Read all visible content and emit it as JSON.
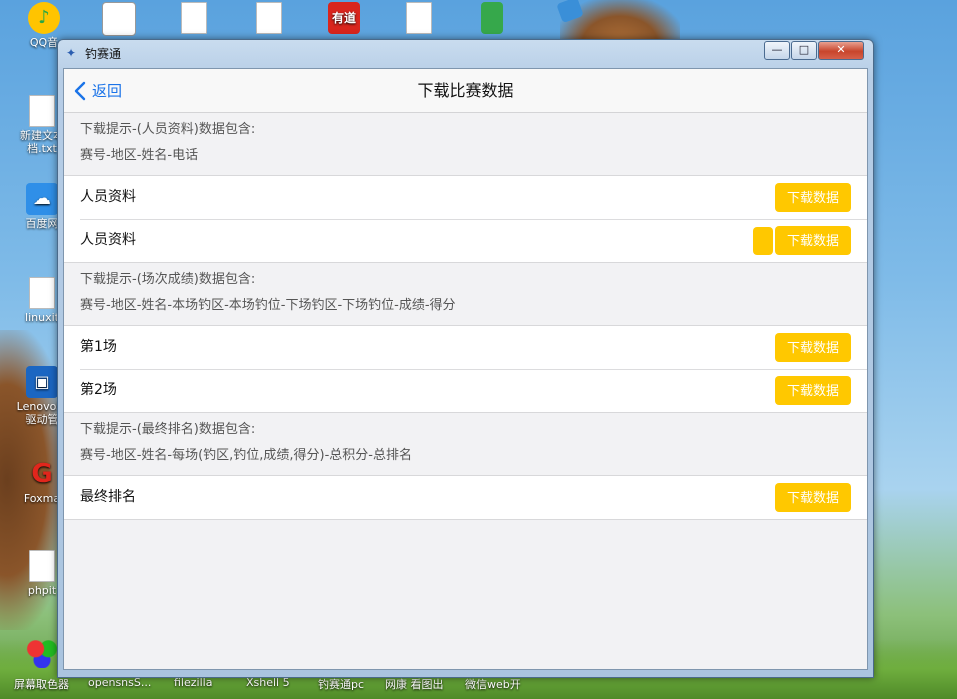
{
  "desktop": {
    "icons": [
      {
        "name": "qq-music",
        "label": "QQ音"
      },
      {
        "name": "new-text-doc",
        "label": "新建文本\n档.txt"
      },
      {
        "name": "baidu-netdisk",
        "label": "百度网"
      },
      {
        "name": "linux-txt",
        "label": "linuxit"
      },
      {
        "name": "lenovo-driver",
        "label": "Lenovo驱\n驱动管"
      },
      {
        "name": "foxmail",
        "label": "Foxma"
      },
      {
        "name": "php-txt",
        "label": "phpit"
      }
    ],
    "top_icons": [
      {
        "name": "youdao",
        "label": "有道"
      }
    ],
    "taskbar_labels": [
      "屏幕取色器",
      "opensnsS...",
      "filezilla",
      "Xshell 5",
      "钓赛通pc",
      "网康 看图出",
      "微信web开"
    ]
  },
  "window": {
    "title": "钓赛通",
    "min": "—",
    "max": "□",
    "close": "✕"
  },
  "navbar": {
    "back_label": "返回",
    "title": "下载比赛数据"
  },
  "sections": [
    {
      "hint_title": "下载提示-(人员资料)数据包含:",
      "hint_fields": "赛号-地区-姓名-电话",
      "rows": [
        {
          "label": "人员资料",
          "button": "下载数据"
        },
        {
          "label": "人员资料",
          "button": "下载数据"
        }
      ]
    },
    {
      "hint_title": "下载提示-(场次成绩)数据包含:",
      "hint_fields": "赛号-地区-姓名-本场钓区-本场钓位-下场钓区-下场钓位-成绩-得分",
      "rows": [
        {
          "label": "第1场",
          "button": "下载数据"
        },
        {
          "label": "第2场",
          "button": "下载数据"
        }
      ]
    },
    {
      "hint_title": "下载提示-(最终排名)数据包含:",
      "hint_fields": "赛号-地区-姓名-每场(钓区,钓位,成绩,得分)-总积分-总排名",
      "rows": [
        {
          "label": "最终排名",
          "button": "下载数据"
        }
      ]
    }
  ],
  "colors": {
    "accent_button": "#ffc800",
    "link_blue": "#1a73e8"
  }
}
